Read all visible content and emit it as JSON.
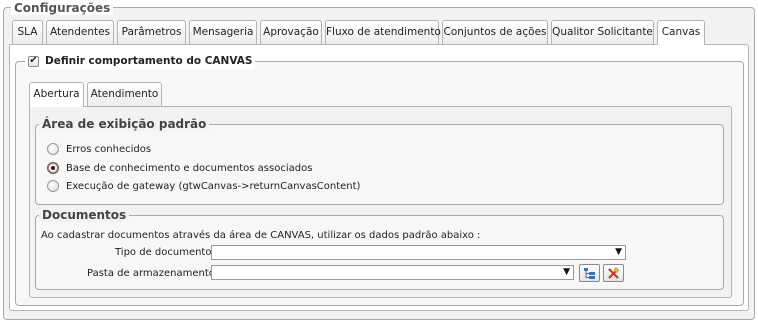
{
  "configuracoes": {
    "title": "Configurações",
    "tabs": [
      {
        "label": "SLA",
        "active": false
      },
      {
        "label": "Atendentes",
        "active": false
      },
      {
        "label": "Parâmetros",
        "active": false
      },
      {
        "label": "Mensageria",
        "active": false
      },
      {
        "label": "Aprovação",
        "active": false
      },
      {
        "label": "Fluxo de atendimento",
        "active": false
      },
      {
        "label": "Conjuntos de ações",
        "active": false
      },
      {
        "label": "Qualitor Solicitante",
        "active": false
      },
      {
        "label": "Canvas",
        "active": true
      }
    ]
  },
  "canvas": {
    "checkbox_label": "Definir comportamento do CANVAS",
    "checked": true,
    "inner_tabs": [
      {
        "label": "Abertura",
        "active": true
      },
      {
        "label": "Atendimento",
        "active": false
      }
    ],
    "area": {
      "title": "Área de exibição padrão",
      "options": [
        {
          "label": "Erros conhecidos",
          "checked": false
        },
        {
          "label": "Base de conhecimento e documentos associados",
          "checked": true
        },
        {
          "label": "Execução de gateway (gtwCanvas->returnCanvasContent)",
          "checked": false
        }
      ]
    },
    "documentos": {
      "title": "Documentos",
      "description": "Ao cadastrar documentos através da área de CANVAS, utilizar os dados padrão abaixo :",
      "tipo_label": "Tipo de documento :",
      "tipo_value": "",
      "pasta_label": "Pasta de armazenamento :",
      "pasta_value": ""
    }
  },
  "icons": {
    "dropdown": "triangle-down",
    "tree": "folder-tree-icon",
    "clear": "clear-x-icon"
  }
}
